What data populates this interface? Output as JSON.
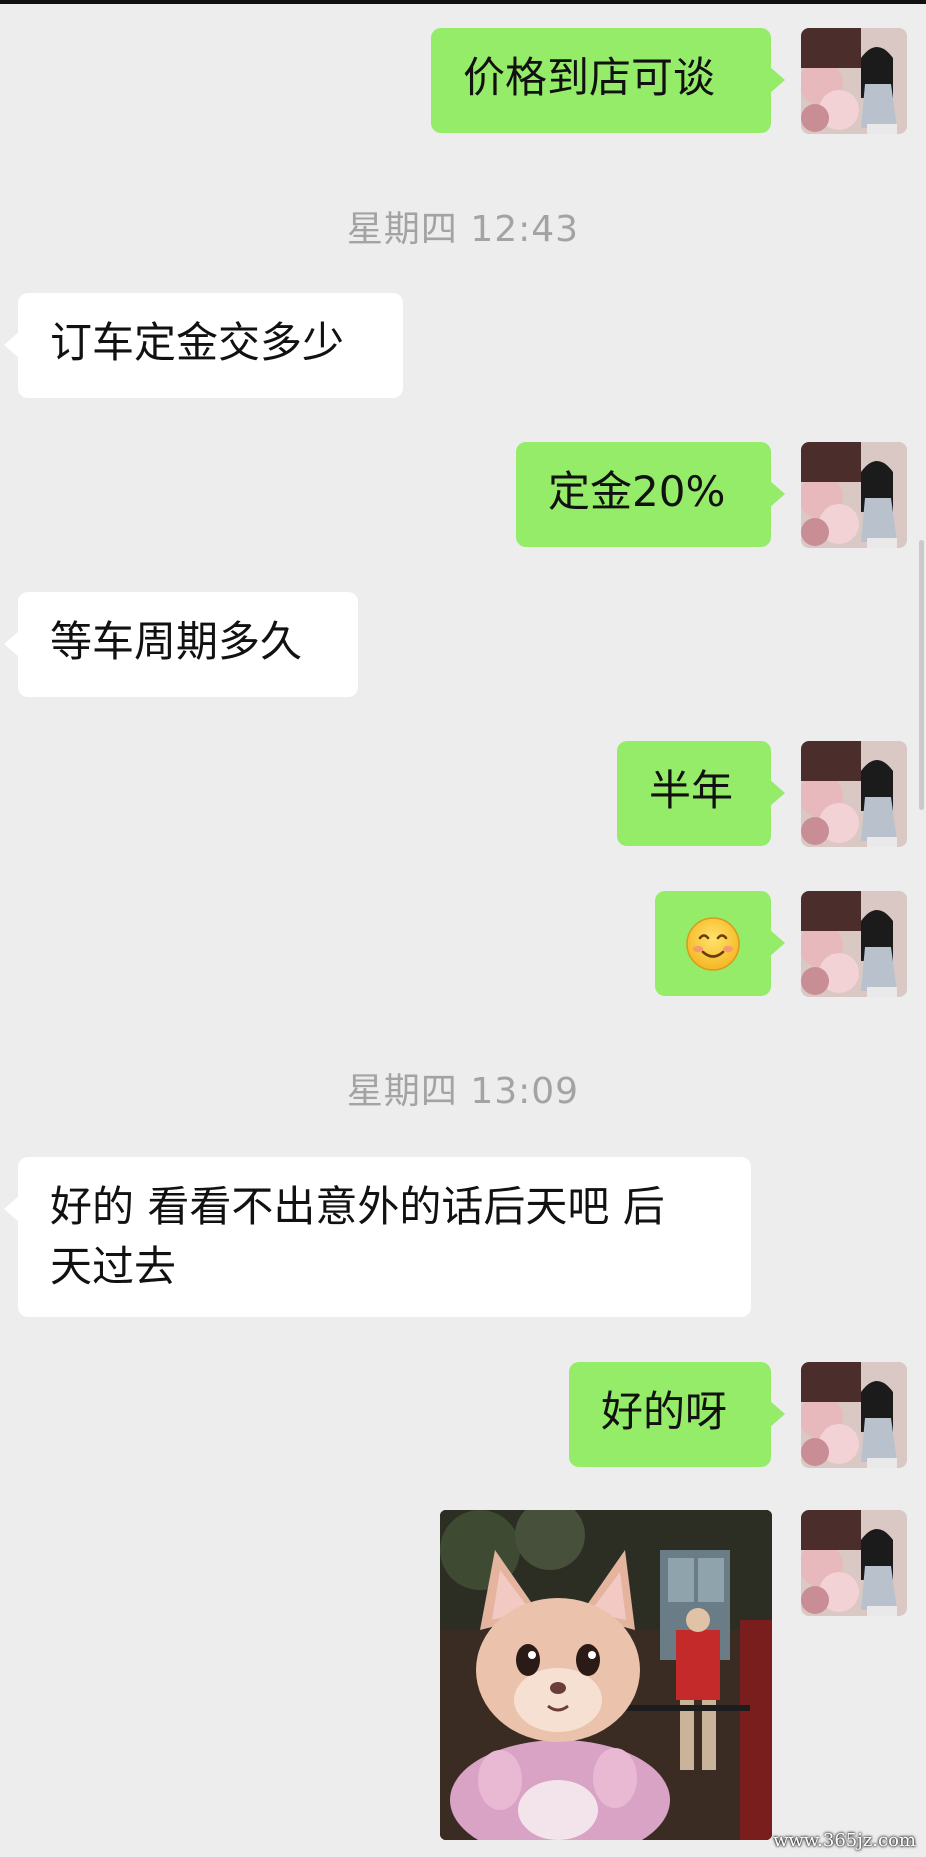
{
  "messages": [
    {
      "kind": "out",
      "text": "价格到店可谈"
    },
    {
      "kind": "time",
      "text": "星期四 12:43"
    },
    {
      "kind": "in",
      "text": "订车定金交多少"
    },
    {
      "kind": "out",
      "text": "定金20%"
    },
    {
      "kind": "in",
      "text": "等车周期多久"
    },
    {
      "kind": "out",
      "text": "半年"
    },
    {
      "kind": "out",
      "emoji": "smiling-face"
    },
    {
      "kind": "time",
      "text": "星期四 13:09"
    },
    {
      "kind": "in",
      "text": "好的 看看不出意外的话后天吧 后\n天过去"
    },
    {
      "kind": "out",
      "text": "好的呀"
    },
    {
      "kind": "out",
      "sticker": "fox-mascot-sticker"
    }
  ],
  "watermark": "www.365jz.com",
  "colors": {
    "background": "#ededed",
    "outgoing_bubble": "#95ec69",
    "incoming_bubble": "#ffffff",
    "timestamp": "#a3a3a3"
  }
}
